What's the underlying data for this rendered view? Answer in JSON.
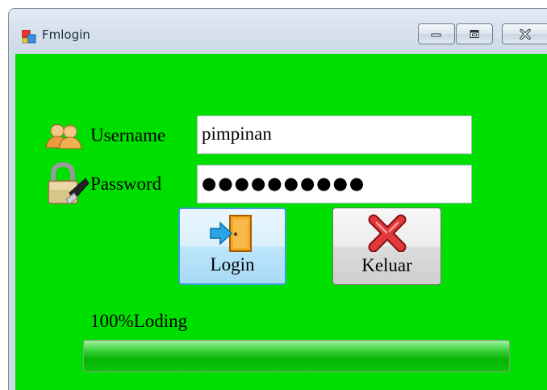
{
  "window": {
    "title": "Fmlogin"
  },
  "form": {
    "username_label": "Username",
    "username_value": "pimpinan",
    "password_label": "Password",
    "password_value": "●●●●●●●●●●"
  },
  "buttons": {
    "login_label": "Login",
    "exit_label": "Keluar"
  },
  "progress": {
    "label": "100%Loding",
    "percent": 100
  },
  "colors": {
    "background": "#00e000",
    "progress_fill": "#06b406"
  }
}
